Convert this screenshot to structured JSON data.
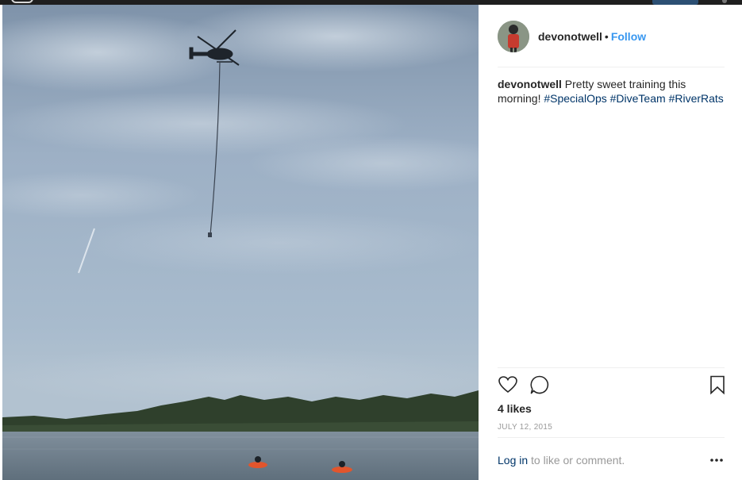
{
  "post": {
    "username": "devonotwell",
    "separator": "•",
    "follow_label": "Follow",
    "caption": {
      "user": "devonotwell",
      "text": "Pretty sweet training this morning!",
      "hashtags": [
        "#SpecialOps",
        "#DiveTeam",
        "#RiverRats"
      ]
    },
    "likes": "4 likes",
    "date": "JULY 12, 2015",
    "login_link": "Log in",
    "login_rest": "to like or comment.",
    "icons": {
      "like": "heart-icon",
      "comment": "comment-bubble-icon",
      "save": "bookmark-icon",
      "more": "more-options-icon"
    }
  },
  "photo": {
    "description_colors": {
      "sky_top": "#8fa4bb",
      "sky_mid": "#a9bccf",
      "water": "#6f7f8c",
      "trees": "#2e3f2b"
    }
  },
  "colors": {
    "link_blue": "#3897f0",
    "hashtag_blue": "#003569",
    "text": "#262626",
    "muted": "#999999"
  }
}
